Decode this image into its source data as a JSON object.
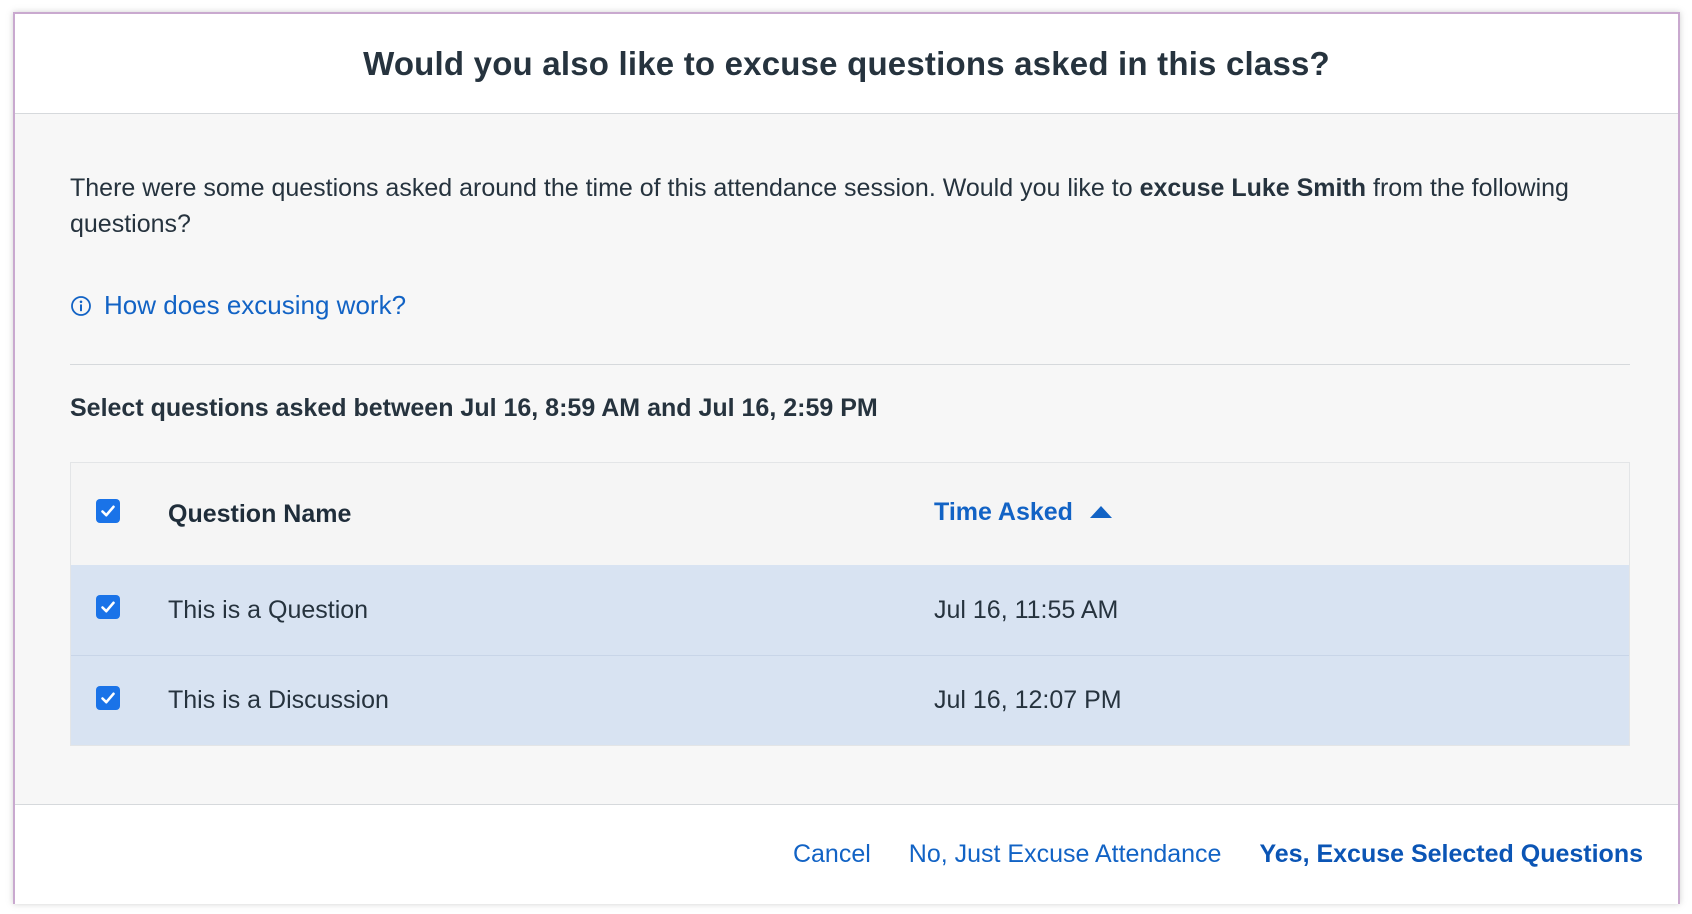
{
  "dialog": {
    "title": "Would you also like to excuse questions asked in this class?",
    "intro_pre": "There were some questions asked around the time of this attendance session. Would you like to ",
    "intro_bold": "excuse Luke Smith",
    "intro_post": " from the following questions?",
    "help_link": "How does excusing work?",
    "range_text": "Select questions asked between Jul 16, 8:59 AM and Jul 16, 2:59 PM"
  },
  "table": {
    "columns": {
      "name": "Question Name",
      "time": "Time Asked"
    },
    "select_all_checked": true,
    "sort_direction": "ascending",
    "rows": [
      {
        "name": "This is a Question",
        "time": "Jul 16, 11:55 AM",
        "checked": true
      },
      {
        "name": "This is a Discussion",
        "time": "Jul 16, 12:07 PM",
        "checked": true
      }
    ]
  },
  "footer": {
    "cancel": "Cancel",
    "no_button": "No, Just Excuse Attendance",
    "yes_button": "Yes, Excuse Selected Questions"
  },
  "colors": {
    "accent": "#1263c5",
    "checkbox": "#1a73e8",
    "selected_row": "#d8e3f2"
  },
  "icons": {
    "help": "info-circle-icon",
    "sort": "caret-up-icon",
    "checkbox": "checkmark-icon"
  }
}
